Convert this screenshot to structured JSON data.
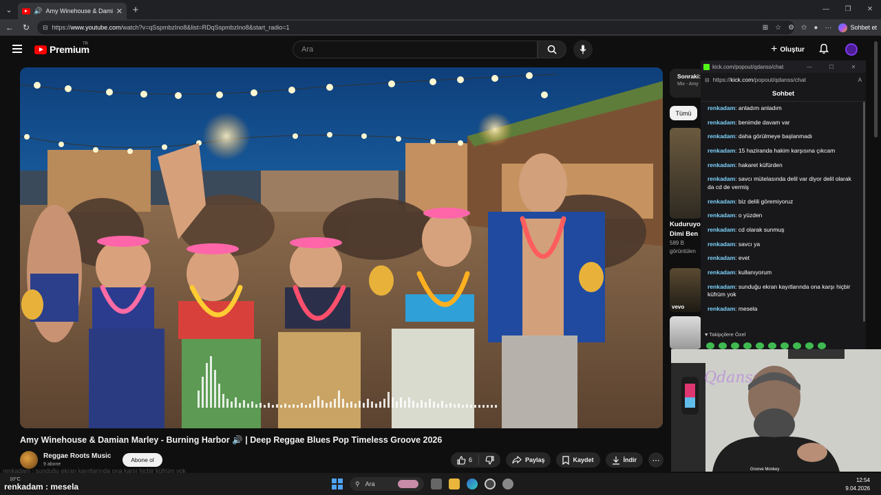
{
  "browser": {
    "tab_title": "Amy Winehouse & Damian Marley - Burning Harbor",
    "url_prefix": "https://",
    "url_host": "www.youtube.com",
    "url_rest": "/watch?v=qSspmbzIno8&list=RDqSspmbzIno8&start_radio=1",
    "copilot_label": "Sohbet et"
  },
  "youtube": {
    "logo_text": "Premium",
    "country_code": "TR",
    "search_placeholder": "Ara",
    "create_label": "Oluştur"
  },
  "video": {
    "title": "Amy Winehouse & Damian Marley - Burning Harbor 🔊 | Deep Reggae Blues Pop Timeless Groove 2026",
    "channel": "Reggae Roots Music",
    "subscribers": "9 abone",
    "subscribe_label": "Abone ol",
    "likes": "6",
    "share_label": "Paylaş",
    "save_label": "Kaydet",
    "download_label": "İndir"
  },
  "sidebar": {
    "up_next_title": "Sonraki:",
    "up_next_sub": "Mix - Amy",
    "chip_all": "Tümü",
    "rec1_title": "Kuduruyo",
    "rec1_title2": "Dimi Ben",
    "rec1_views": "589 B",
    "rec1_views2": "görüntülen",
    "rec2_badge": "vevo"
  },
  "chat": {
    "window_title": "kick.com/popout/qdanss/chat",
    "url_prefix": "https://",
    "url_host": "kick.com",
    "url_rest": "/popout/qdanss/chat",
    "header": "Sohbet",
    "messages": [
      {
        "user": "renkadam",
        "text": "anladım anladım"
      },
      {
        "user": "renkadam",
        "text": "benimde davam var"
      },
      {
        "user": "renkadam",
        "text": "daha görülmeye başlanmadı"
      },
      {
        "user": "renkadam",
        "text": "15 haziranda hakim karşısına çıkcam"
      },
      {
        "user": "renkadam",
        "text": "hakaret küfürden"
      },
      {
        "user": "renkadam",
        "text": "savcı mütelasında delil var diyor delil olarak da cd de vermiş"
      },
      {
        "user": "renkadam",
        "text": "biz delili göremiyoruz"
      },
      {
        "user": "renkadam",
        "text": "o yüzden"
      },
      {
        "user": "renkadam",
        "text": "cd olarak sunmuş"
      },
      {
        "user": "renkadam",
        "text": "savcı ya"
      },
      {
        "user": "renkadam",
        "text": "evet"
      },
      {
        "user": "renkadam",
        "text": "kullanıyorum"
      },
      {
        "user": "renkadam",
        "text": "sunduğu ekran kayıtlarında ona karşı hiçbir küfrüm yok"
      },
      {
        "user": "renkadam",
        "text": "mesela"
      }
    ],
    "followers_only": "Takipçilere Özel"
  },
  "webcam": {
    "name_label": "Qdanss",
    "song_label": "Groove Monkey"
  },
  "overlay": {
    "faint_text": "renkadam : sunduğu ekran kayıtlarında ona karşı hiçbir küfrüm yok",
    "user": "renkadam",
    "message": "mesela"
  },
  "taskbar": {
    "weather": "10°C",
    "search_label": "Ara",
    "time": "12:54",
    "date": "9.04.2026"
  },
  "colors": {
    "accent_red": "#ff0000",
    "chat_username": "#7dd3fc",
    "kick_green": "#53fc18"
  }
}
